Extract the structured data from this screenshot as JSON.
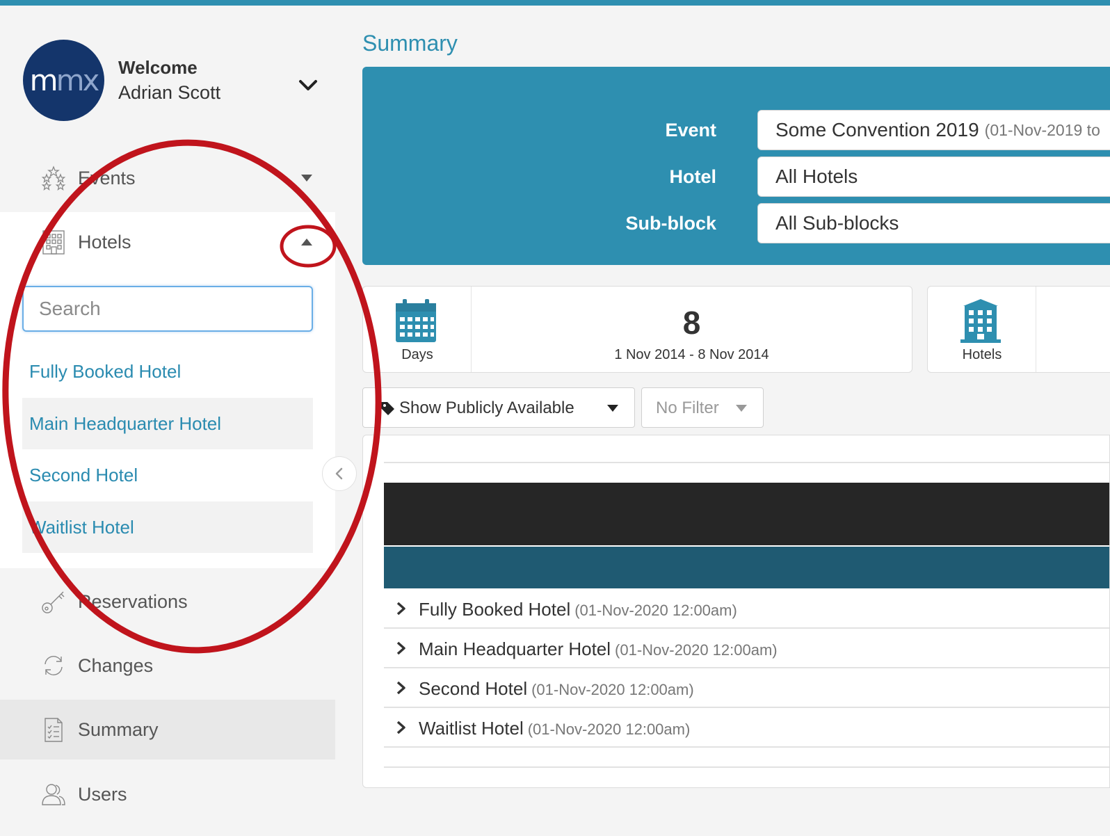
{
  "sidebar": {
    "logo": {
      "part1": "m",
      "part2": "mx"
    },
    "welcome": "Welcome",
    "username": "Adrian Scott",
    "nav": {
      "events": "Events",
      "hotels": "Hotels",
      "reservations": "Reservations",
      "changes": "Changes",
      "summary": "Summary",
      "users": "Users"
    },
    "search_placeholder": "Search",
    "hotel_list": [
      "Fully Booked Hotel",
      "Main Headquarter Hotel",
      "Second Hotel",
      "Waitlist Hotel"
    ]
  },
  "main": {
    "title": "Summary",
    "filters": {
      "event_label": "Event",
      "event_value": "Some Convention 2019",
      "event_sub": "(01-Nov-2019 to",
      "hotel_label": "Hotel",
      "hotel_value": "All Hotels",
      "subblock_label": "Sub-block",
      "subblock_value": "All Sub-blocks"
    },
    "stats": {
      "days_caption": "Days",
      "days_count": "8",
      "days_range": "1 Nov 2014 - 8 Nov 2014",
      "hotels_caption": "Hotels"
    },
    "toolbar": {
      "availability": "Show Publicly Available",
      "filter": "No Filter"
    },
    "rows": [
      {
        "name": "Fully Booked Hotel",
        "date": "(01-Nov-2020 12:00am)"
      },
      {
        "name": "Main Headquarter Hotel",
        "date": "(01-Nov-2020 12:00am)"
      },
      {
        "name": "Second Hotel",
        "date": "(01-Nov-2020 12:00am)"
      },
      {
        "name": "Waitlist Hotel",
        "date": "(01-Nov-2020 12:00am)"
      }
    ]
  },
  "colors": {
    "accent": "#2e8fb0",
    "logo": "#14356b",
    "annotation": "#c0141c",
    "dark_band": "#262626",
    "teal_band": "#1f5a72"
  }
}
